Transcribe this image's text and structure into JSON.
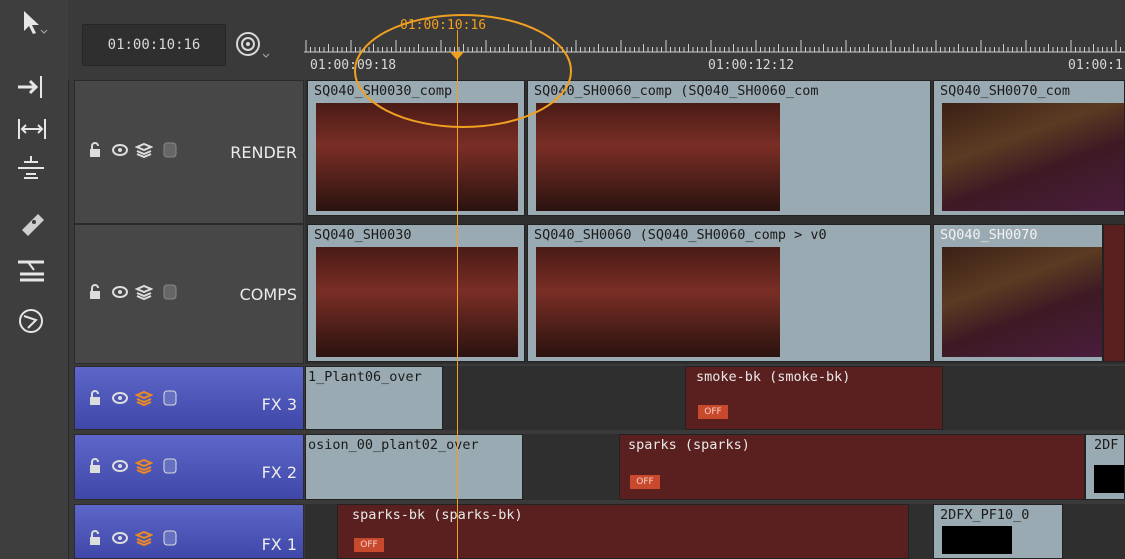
{
  "current_timecode": "01:00:10:16",
  "playhead_timecode": "01:00:10:16",
  "ruler": {
    "labels": [
      "01:00:09:18",
      "01:00:12:12",
      "01:00:1"
    ]
  },
  "tools": [
    "select-tool-icon",
    "track-select-tool-icon",
    "slip-tool-icon",
    "slide-tool-icon",
    "razor-tool-icon",
    "ripple-tool-icon",
    "retime-tool-icon"
  ],
  "tracks": [
    {
      "name": "RENDER",
      "type": "video"
    },
    {
      "name": "COMPS",
      "type": "video"
    },
    {
      "name": "FX 3",
      "type": "fx"
    },
    {
      "name": "FX 2",
      "type": "fx"
    },
    {
      "name": "FX 1",
      "type": "fx"
    }
  ],
  "clips": {
    "render_1": "SQ040_SH0030_comp",
    "render_2": "SQ040_SH0060_comp (SQ040_SH0060_com",
    "render_3": "SQ040_SH0070_com",
    "comps_1": "SQ040_SH0030",
    "comps_2": "SQ040_SH0060 (SQ040_SH0060_comp > v0",
    "comps_3": "SQ040_SH0070",
    "fx3_1": "1_Plant06_over",
    "fx3_2": "smoke-bk (smoke-bk)",
    "fx2_1": "osion_00_plant02_over",
    "fx2_2": "sparks (sparks)",
    "fx2_3": "2DF",
    "fx1_1": "sparks-bk (sparks-bk)",
    "fx1_2": "2DFX_PF10_0"
  },
  "off_label": "OFF",
  "colors": {
    "playhead": "#f0a020",
    "fx_header": "#4e58bb",
    "fx_clip": "#5a1f1f",
    "video_clip": "#9aaab2"
  }
}
